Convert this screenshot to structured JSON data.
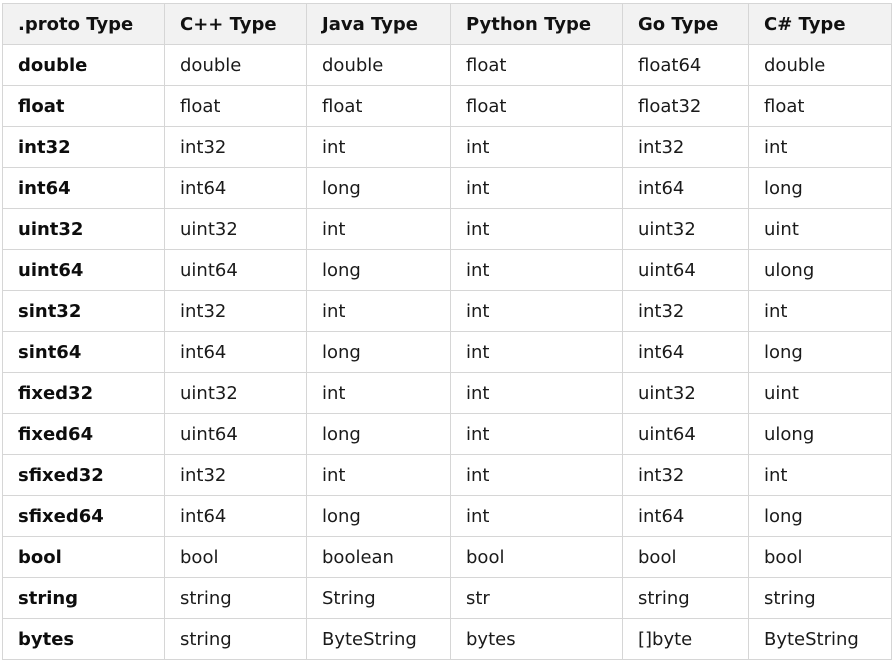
{
  "table": {
    "headers": [
      ".proto Type",
      "C++ Type",
      "Java Type",
      "Python Type",
      "Go Type",
      "C# Type"
    ],
    "rows": [
      [
        "double",
        "double",
        "double",
        "float",
        "float64",
        "double"
      ],
      [
        "float",
        "float",
        "float",
        "float",
        "float32",
        "float"
      ],
      [
        "int32",
        "int32",
        "int",
        "int",
        "int32",
        "int"
      ],
      [
        "int64",
        "int64",
        "long",
        "int",
        "int64",
        "long"
      ],
      [
        "uint32",
        "uint32",
        "int",
        "int",
        "uint32",
        "uint"
      ],
      [
        "uint64",
        "uint64",
        "long",
        "int",
        "uint64",
        "ulong"
      ],
      [
        "sint32",
        "int32",
        "int",
        "int",
        "int32",
        "int"
      ],
      [
        "sint64",
        "int64",
        "long",
        "int",
        "int64",
        "long"
      ],
      [
        "fixed32",
        "uint32",
        "int",
        "int",
        "uint32",
        "uint"
      ],
      [
        "fixed64",
        "uint64",
        "long",
        "int",
        "uint64",
        "ulong"
      ],
      [
        "sfixed32",
        "int32",
        "int",
        "int",
        "int32",
        "int"
      ],
      [
        "sfixed64",
        "int64",
        "long",
        "int",
        "int64",
        "long"
      ],
      [
        "bool",
        "bool",
        "boolean",
        "bool",
        "bool",
        "bool"
      ],
      [
        "string",
        "string",
        "String",
        "str",
        "string",
        "string"
      ],
      [
        "bytes",
        "string",
        "ByteString",
        "bytes",
        "[]byte",
        "ByteString"
      ]
    ]
  }
}
